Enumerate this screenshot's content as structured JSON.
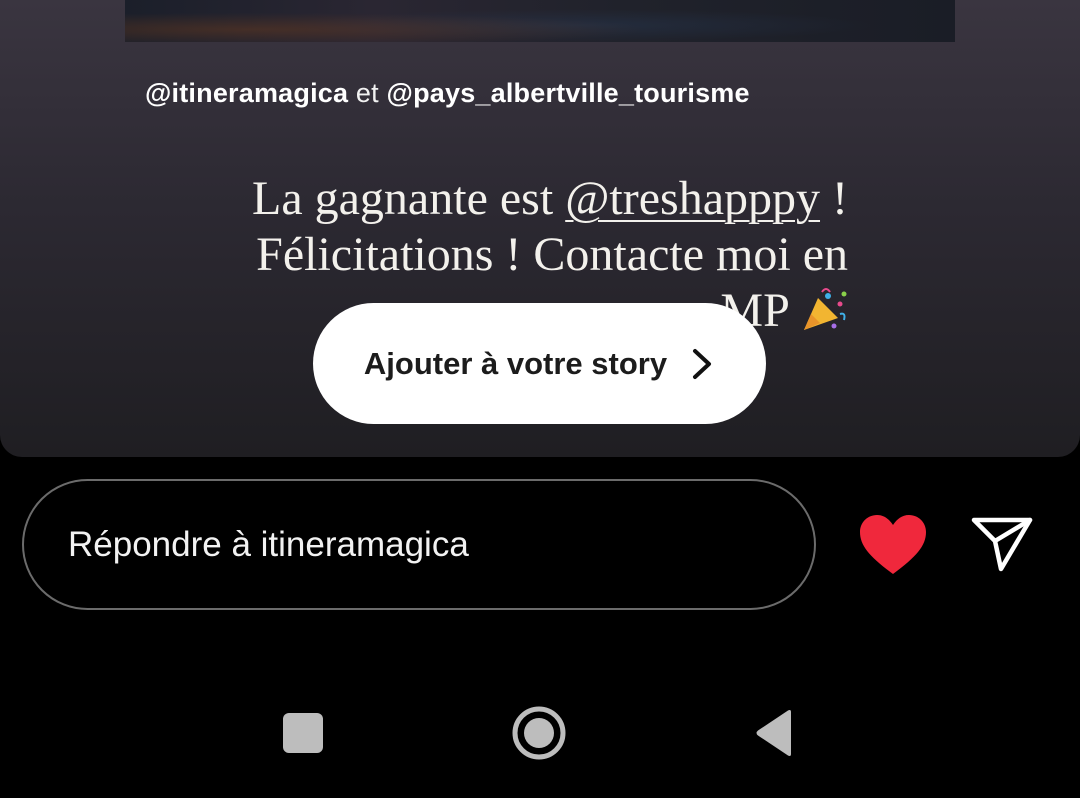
{
  "story": {
    "mention_1": "@itineramagica",
    "conjunction": "et",
    "mention_2": "@pays_albertville_tourisme",
    "text_part_1": "La gagnante est",
    "winner_mention": "@treshapppy",
    "text_part_2": "!",
    "text_line_2": "Félicitations ! Contacte moi en",
    "text_line_3": "MP",
    "emoji_icon": "party-popper-icon"
  },
  "add_to_story": {
    "label": "Ajouter à votre story",
    "icon": "chevron-right-icon"
  },
  "reply": {
    "placeholder": "Répondre à itineramagica"
  },
  "actions": {
    "like_icon": "heart-icon",
    "like_color": "#f0283c",
    "share_icon": "send-icon"
  },
  "system_nav": {
    "recents_icon": "square-icon",
    "home_icon": "circle-icon",
    "back_icon": "triangle-back-icon"
  }
}
